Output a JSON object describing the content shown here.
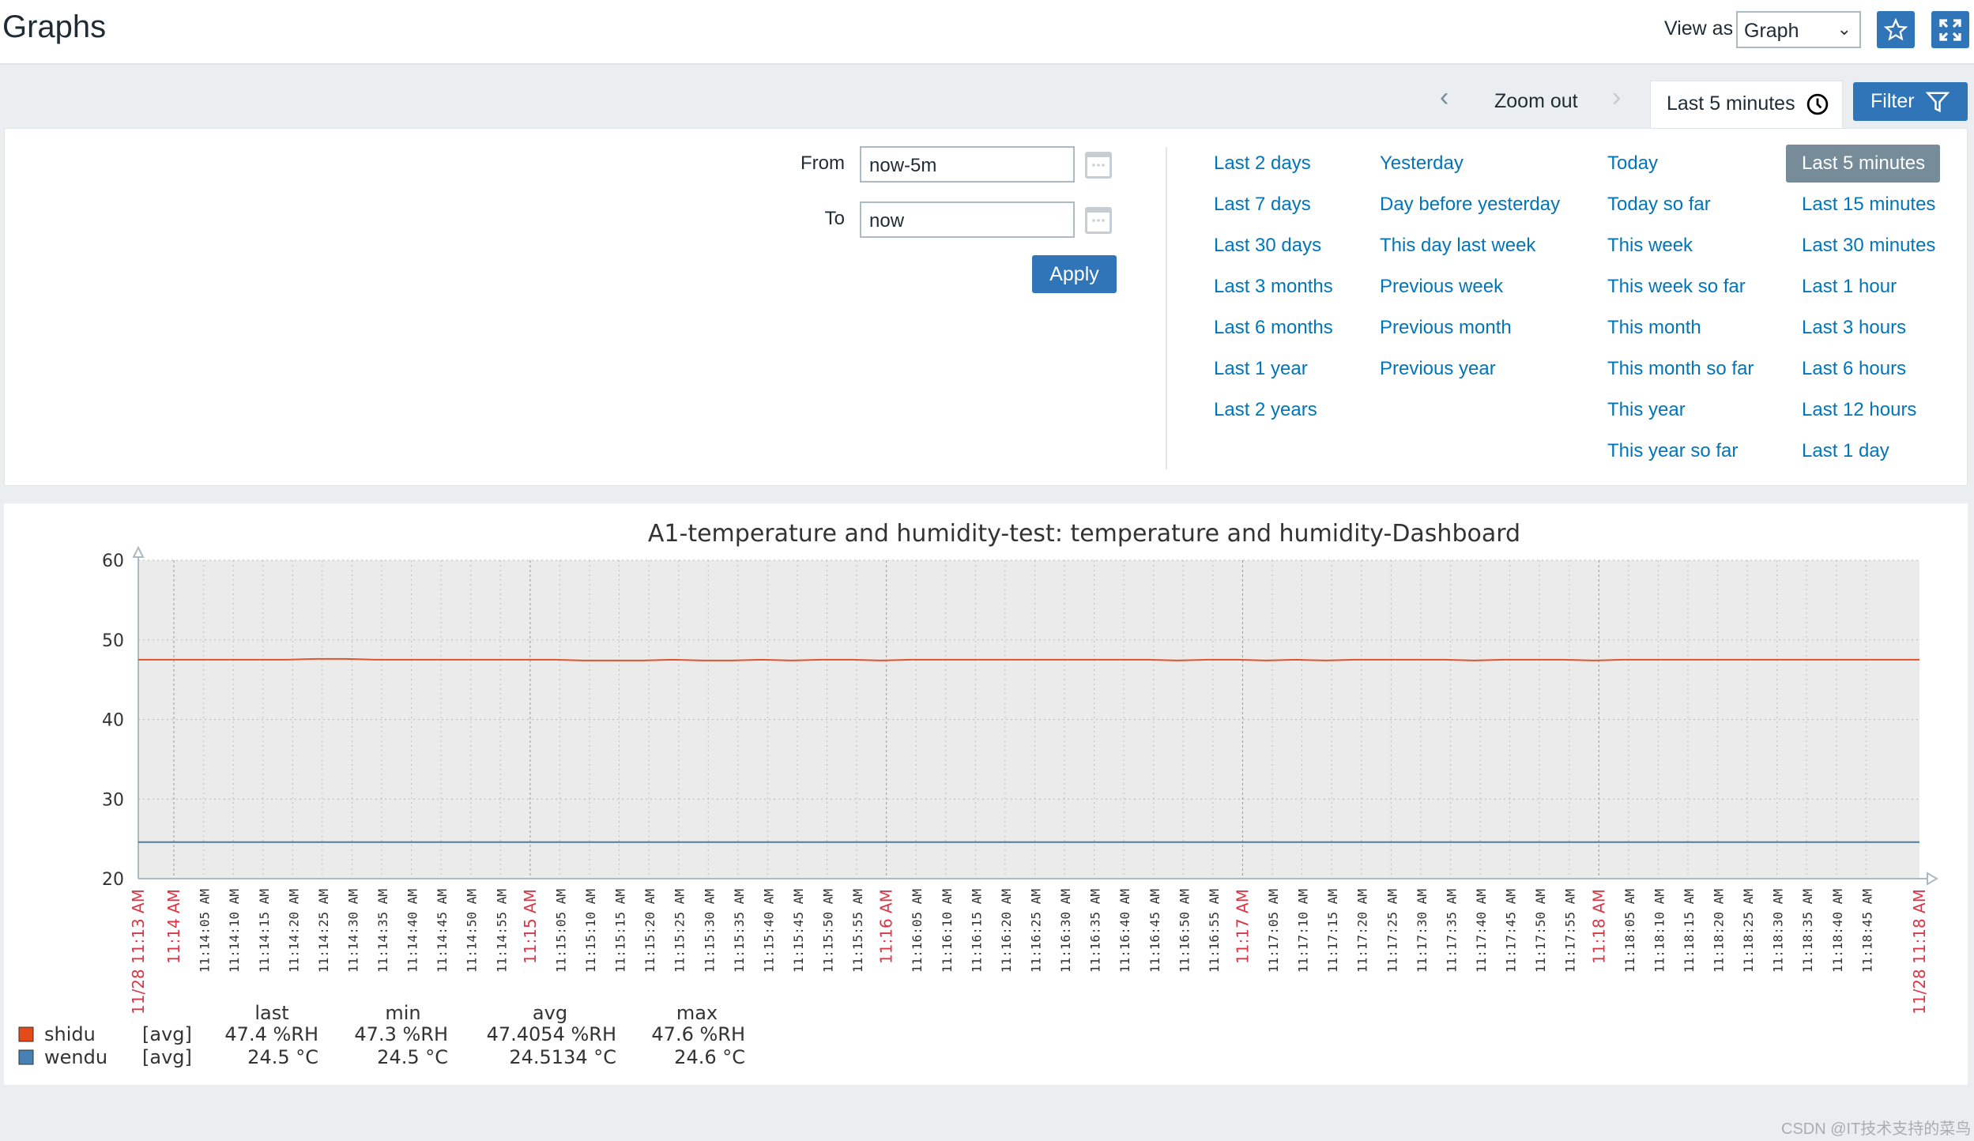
{
  "header": {
    "title": "Graphs",
    "view_as_label": "View as",
    "view_as_value": "Graph",
    "icons": {
      "favorite": "star-icon",
      "fullscreen": "fullscreen-icon"
    }
  },
  "timebar": {
    "prev": "chevron-left-icon",
    "zoom_out": "Zoom out",
    "next": "chevron-right-icon",
    "tab_label": "Last 5 minutes",
    "tab_icon": "clock-icon",
    "filter_label": "Filter",
    "filter_icon": "funnel-icon"
  },
  "filter": {
    "from_label": "From",
    "from_value": "now-5m",
    "to_label": "To",
    "to_value": "now",
    "apply": "Apply",
    "columns": [
      [
        "Last 2 days",
        "Last 7 days",
        "Last 30 days",
        "Last 3 months",
        "Last 6 months",
        "Last 1 year",
        "Last 2 years"
      ],
      [
        "Yesterday",
        "Day before yesterday",
        "This day last week",
        "Previous week",
        "Previous month",
        "Previous year"
      ],
      [
        "Today",
        "Today so far",
        "This week",
        "This week so far",
        "This month",
        "This month so far",
        "This year",
        "This year so far"
      ],
      [
        "Last 5 minutes",
        "Last 15 minutes",
        "Last 30 minutes",
        "Last 1 hour",
        "Last 3 hours",
        "Last 6 hours",
        "Last 12 hours",
        "Last 1 day"
      ]
    ],
    "active": "Last 5 minutes"
  },
  "colors": {
    "accent": "#2f75b7",
    "link": "#0275b8",
    "active_bg": "#768d99",
    "major_tick": "#dc3545"
  },
  "chart_data": {
    "type": "line",
    "title": "A1-temperature and humidity-test: temperature and humidity-Dashboard",
    "ylim": [
      20,
      60
    ],
    "yticks": [
      "60",
      "50",
      "40",
      "30",
      "20"
    ],
    "x_range": [
      "11:13:54",
      "11:18:54"
    ],
    "x_start_label": "11/28 11:13 AM",
    "x_end_label": "11/28 11:18 AM",
    "grid": true,
    "xticks": [
      "11:14 AM",
      "11:14:05 AM",
      "11:14:10 AM",
      "11:14:15 AM",
      "11:14:20 AM",
      "11:14:25 AM",
      "11:14:30 AM",
      "11:14:35 AM",
      "11:14:40 AM",
      "11:14:45 AM",
      "11:14:50 AM",
      "11:14:55 AM",
      "11:15 AM",
      "11:15:05 AM",
      "11:15:10 AM",
      "11:15:15 AM",
      "11:15:20 AM",
      "11:15:25 AM",
      "11:15:30 AM",
      "11:15:35 AM",
      "11:15:40 AM",
      "11:15:45 AM",
      "11:15:50 AM",
      "11:15:55 AM",
      "11:16 AM",
      "11:16:05 AM",
      "11:16:10 AM",
      "11:16:15 AM",
      "11:16:20 AM",
      "11:16:25 AM",
      "11:16:30 AM",
      "11:16:35 AM",
      "11:16:40 AM",
      "11:16:45 AM",
      "11:16:50 AM",
      "11:16:55 AM",
      "11:17 AM",
      "11:17:05 AM",
      "11:17:10 AM",
      "11:17:15 AM",
      "11:17:20 AM",
      "11:17:25 AM",
      "11:17:30 AM",
      "11:17:35 AM",
      "11:17:40 AM",
      "11:17:45 AM",
      "11:17:50 AM",
      "11:17:55 AM",
      "11:18 AM",
      "11:18:05 AM",
      "11:18:10 AM",
      "11:18:15 AM",
      "11:18:20 AM",
      "11:18:25 AM",
      "11:18:30 AM",
      "11:18:35 AM",
      "11:18:40 AM",
      "11:18:45 AM"
    ],
    "series": [
      {
        "name": "shidu",
        "color": "#e0542e",
        "values": [
          47.5,
          47.5,
          47.5,
          47.5,
          47.5,
          47.5,
          47.6,
          47.6,
          47.5,
          47.5,
          47.5,
          47.5,
          47.5,
          47.5,
          47.5,
          47.4,
          47.4,
          47.4,
          47.5,
          47.4,
          47.4,
          47.5,
          47.4,
          47.5,
          47.5,
          47.4,
          47.5,
          47.5,
          47.5,
          47.5,
          47.5,
          47.5,
          47.5,
          47.5,
          47.5,
          47.4,
          47.5,
          47.5,
          47.4,
          47.5,
          47.4,
          47.5,
          47.5,
          47.5,
          47.5,
          47.4,
          47.5,
          47.5,
          47.5,
          47.4,
          47.5,
          47.5,
          47.5,
          47.5,
          47.5,
          47.5,
          47.5,
          47.5,
          47.5,
          47.5,
          47.5
        ]
      },
      {
        "name": "wendu",
        "color": "#4e7ca0",
        "values": [
          24.6,
          24.6,
          24.6,
          24.6,
          24.6,
          24.6,
          24.6,
          24.6,
          24.6,
          24.6,
          24.6
        ]
      }
    ],
    "legend": {
      "headers": [
        "last",
        "min",
        "avg",
        "max"
      ],
      "rows": [
        {
          "name": "shidu",
          "func": "[avg]",
          "color": "#e64a19",
          "last": "47.4 %RH",
          "min": "47.3 %RH",
          "avg": "47.4054 %RH",
          "max": "47.6 %RH"
        },
        {
          "name": "wendu",
          "func": "[avg]",
          "color": "#4682b4",
          "last": "24.5 °C",
          "min": "24.5 °C",
          "avg": "24.5134 °C",
          "max": "24.6 °C"
        }
      ]
    }
  },
  "watermark": "CSDN @IT技术支持的菜鸟"
}
